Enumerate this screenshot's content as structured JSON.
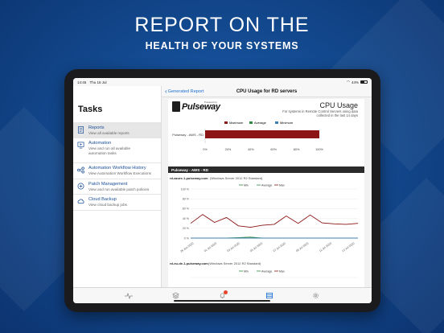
{
  "headline": {
    "line1": "REPORT ON THE",
    "line2": "HEALTH OF YOUR SYSTEMS"
  },
  "statusbar": {
    "time": "14:45",
    "date": "Thu 16 Jul",
    "battery": "44%"
  },
  "sidebar": {
    "title": "Tasks",
    "items": [
      {
        "label": "Reports",
        "sub": "View all available reports",
        "icon": "report-icon",
        "active": true
      },
      {
        "label": "Automation",
        "sub": "View and run all available automation tasks",
        "icon": "automation-icon"
      },
      {
        "label": "Automation Workflow History",
        "sub": "View Automation Workflow Executions",
        "icon": "workflow-icon"
      },
      {
        "label": "Patch Management",
        "sub": "View and run available patch policies",
        "icon": "plus-circle-icon"
      },
      {
        "label": "Cloud Backup",
        "sub": "View cloud backup jobs",
        "icon": "cloud-icon"
      }
    ]
  },
  "nav": {
    "back_label": "Generated Report",
    "title": "CPU Usage for RD servers"
  },
  "report": {
    "logo": "Pulseway",
    "logo_sub": "Powered by",
    "title": "CPU Usage",
    "subtitle": "For systems in Remote Control Servers using data collected in the last 14 days",
    "section": "Pulseway - AWS - RD",
    "server1": "rd-azure-1.pulseway.com",
    "server1_os": "(Windows Server 2012 R2 Standard)",
    "server2": "rd-eu-de-1.pulseway.com",
    "server2_os": "(Windows Server 2012 R2 Standard)"
  },
  "colors": {
    "bar": "#8b1414",
    "avg": "#2e8b3d",
    "min": "#3b7fb5",
    "brand_blue": "#1a4f9a"
  },
  "chart_data": [
    {
      "type": "bar",
      "orientation": "horizontal",
      "categories": [
        "Pulseway - AWS - RD"
      ],
      "series": [
        {
          "name": "Maximum",
          "values": [
            100
          ]
        },
        {
          "name": "Average",
          "values": [
            0
          ]
        },
        {
          "name": "Minimum",
          "values": [
            0
          ]
        }
      ],
      "xlim": [
        0,
        100
      ],
      "xticks": [
        "0%",
        "20%",
        "40%",
        "60%",
        "80%",
        "100%"
      ],
      "legend": "top"
    },
    {
      "type": "line",
      "x": [
        "29 Jun 2020",
        "01 Jul 2020",
        "03 Jul 2020",
        "05 Jul 2020",
        "07 Jul 2020",
        "09 Jul 2020",
        "11 Jul 2020",
        "13 Jul 2020"
      ],
      "yticks": [
        "0 %",
        "20 %",
        "40 %",
        "60 %",
        "80 %",
        "100 %"
      ],
      "ylim": [
        0,
        100
      ],
      "legend": "top",
      "series": [
        {
          "name": "Min",
          "values": [
            0,
            0,
            0,
            0,
            0,
            0,
            0,
            0,
            0,
            0,
            0,
            0,
            0,
            0,
            0
          ]
        },
        {
          "name": "Average",
          "values": [
            0,
            0,
            0,
            0,
            1,
            2,
            0,
            0,
            0,
            0,
            0,
            0,
            0,
            0,
            0
          ]
        },
        {
          "name": "Max",
          "values": [
            30,
            48,
            32,
            42,
            25,
            22,
            26,
            28,
            45,
            30,
            47,
            31,
            29,
            28,
            30
          ]
        }
      ]
    }
  ],
  "legend2": [
    "Min",
    "Average",
    "Max"
  ]
}
